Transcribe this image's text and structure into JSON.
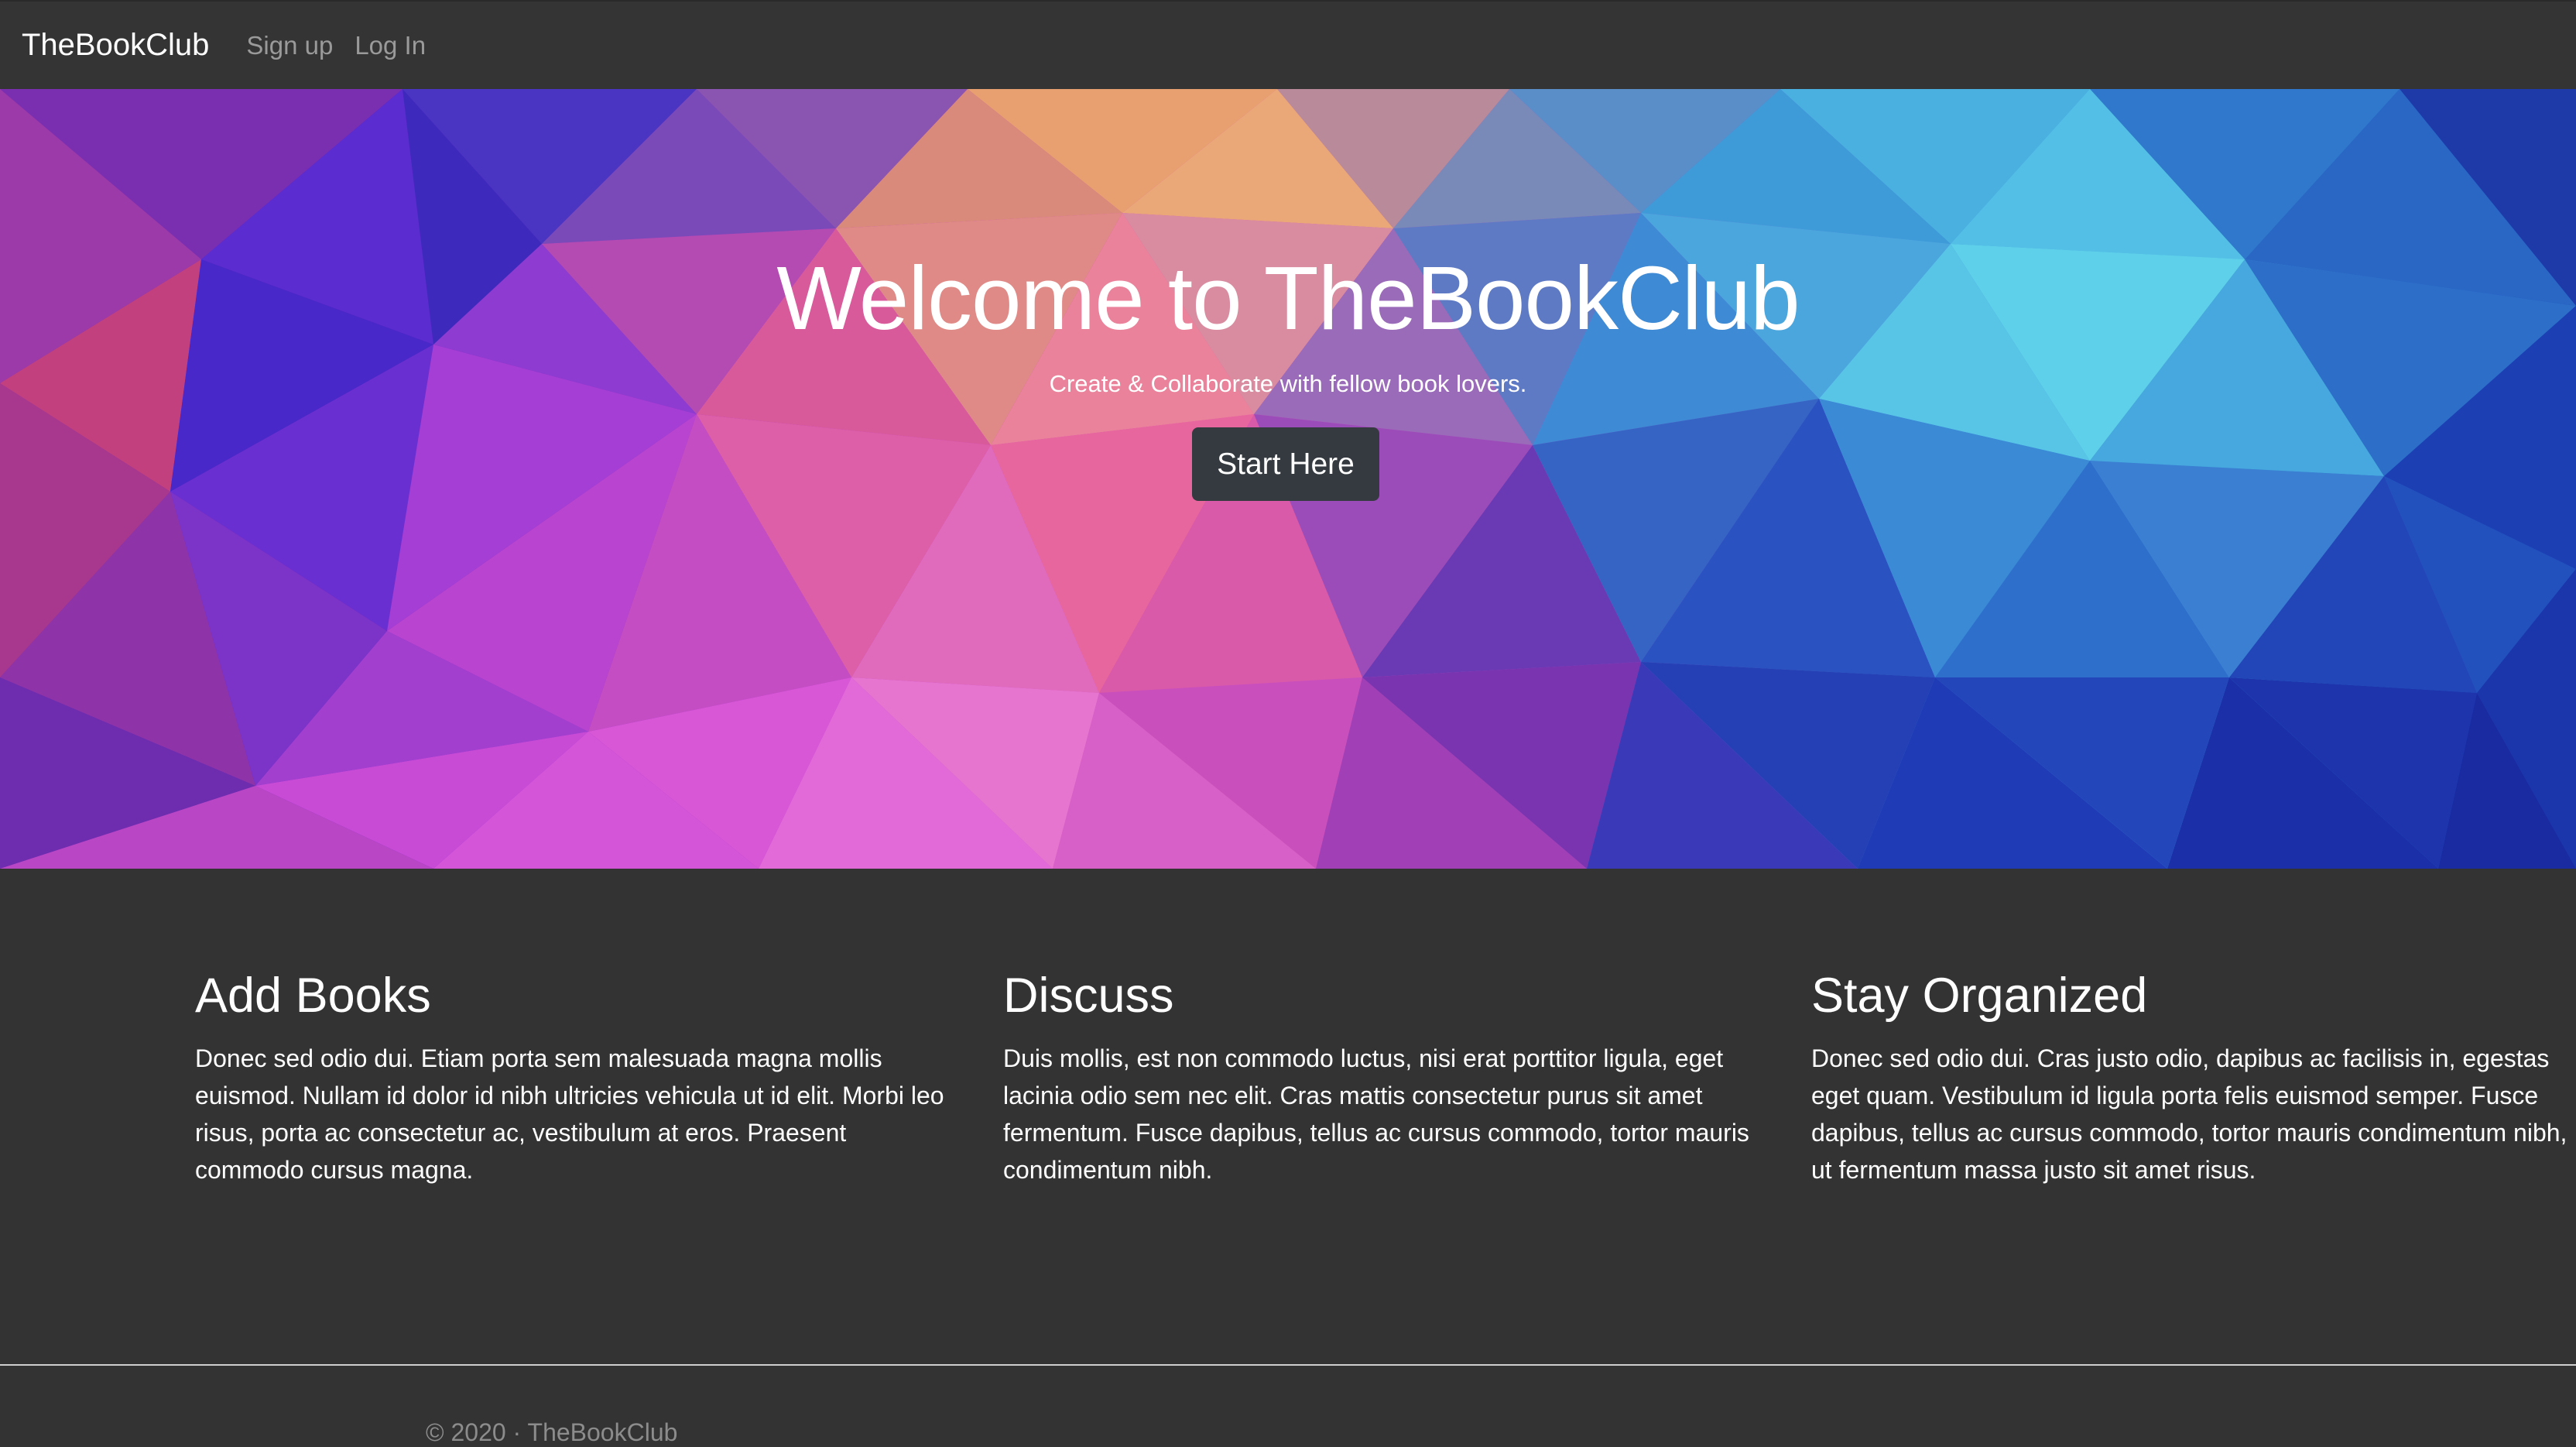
{
  "navbar": {
    "brand": "TheBookClub",
    "links": [
      {
        "label": "Sign up"
      },
      {
        "label": "Log In"
      }
    ]
  },
  "hero": {
    "title": "Welcome to TheBookClub",
    "subtitle": "Create & Collaborate with fellow book lovers.",
    "button_label": "Start Here"
  },
  "features": [
    {
      "heading": "Add Books",
      "body": "Donec sed odio dui. Etiam porta sem malesuada magna mollis euismod. Nullam id dolor id nibh ultricies vehicula ut id elit. Morbi leo risus, porta ac consectetur ac, vestibulum at eros. Praesent commodo cursus magna."
    },
    {
      "heading": "Discuss",
      "body": "Duis mollis, est non commodo luctus, nisi erat porttitor ligula, eget lacinia odio sem nec elit. Cras mattis consectetur purus sit amet fermentum. Fusce dapibus, tellus ac cursus commodo, tortor mauris condimentum nibh."
    },
    {
      "heading": "Stay Organized",
      "body": "Donec sed odio dui. Cras justo odio, dapibus ac facilisis in, egestas eget quam. Vestibulum id ligula porta felis euismod semper. Fusce dapibus, tellus ac cursus commodo, tortor mauris condimentum nibh, ut fermentum massa justo sit amet risus."
    }
  ],
  "footer": {
    "text": "© 2020 · TheBookClub"
  },
  "colors": {
    "navbar_bg": "#343434",
    "page_bg": "#333333",
    "button_bg": "#343a40"
  }
}
